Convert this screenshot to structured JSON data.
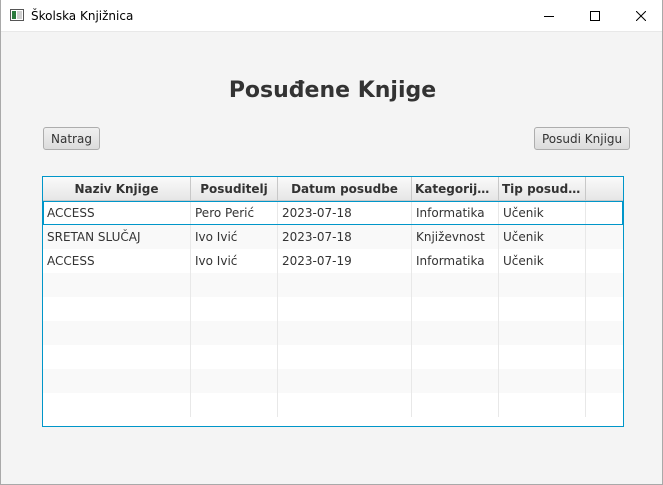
{
  "window": {
    "title": "Školska Knjižnica",
    "icons": {
      "app": "window-app-icon",
      "minimize": "minimize-icon",
      "maximize": "maximize-icon",
      "close": "close-icon"
    }
  },
  "page": {
    "title": "Posuđene Knjige",
    "back_button": "Natrag",
    "borrow_button": "Posudi Knjigu"
  },
  "table": {
    "columns": [
      "Naziv Knjige",
      "Posuditelj",
      "Datum posudbe",
      "Kategorija k...",
      "Tip posudite...",
      ""
    ],
    "rows": [
      [
        "ACCESS",
        "Pero Perić",
        "2023-07-18",
        "Informatika",
        "Učenik"
      ],
      [
        "SRETAN SLUČAJ",
        "Ivo Ivić",
        "2023-07-18",
        "Književnost",
        "Učenik"
      ],
      [
        "ACCESS",
        "Ivo Ivić",
        "2023-07-19",
        "Informatika",
        "Učenik"
      ],
      [
        "",
        "",
        "",
        "",
        ""
      ],
      [
        "",
        "",
        "",
        "",
        ""
      ],
      [
        "",
        "",
        "",
        "",
        ""
      ],
      [
        "",
        "",
        "",
        "",
        ""
      ],
      [
        "",
        "",
        "",
        "",
        ""
      ],
      [
        "",
        "",
        "",
        "",
        ""
      ]
    ],
    "selected_row": 0
  },
  "colors": {
    "focus": "#0096c9",
    "background": "#f4f4f4"
  }
}
